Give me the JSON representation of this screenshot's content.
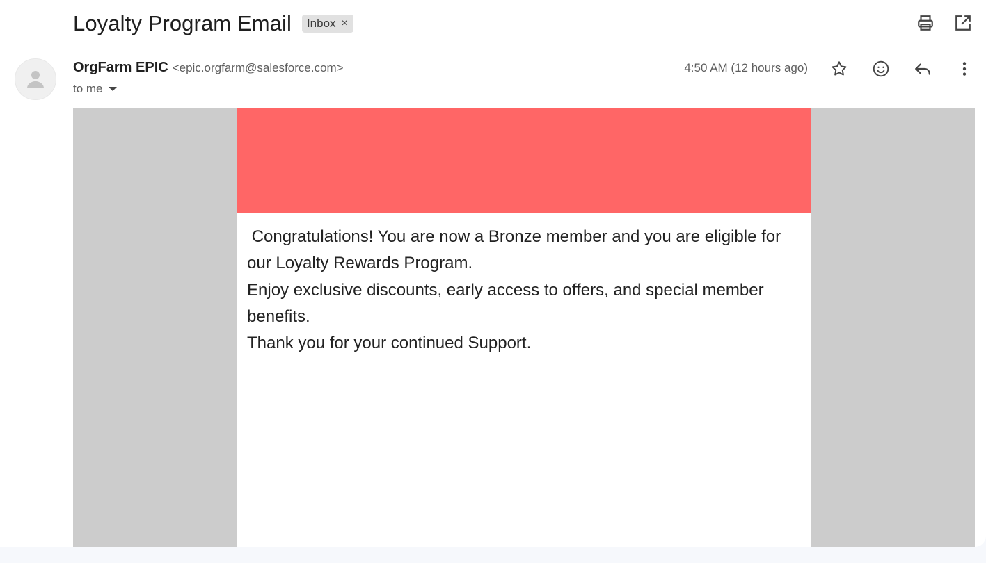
{
  "email": {
    "subject": "Loyalty Program Email",
    "label": "Inbox",
    "label_close": "×",
    "sender_name": "OrgFarm EPIC",
    "sender_email": "<epic.orgfarm@salesforce.com>",
    "recipient": "to me",
    "timestamp": "4:50 AM (12 hours ago)"
  },
  "toolbar": {
    "print_icon": "print-icon",
    "open_new_window_icon": "open-in-new-window-icon"
  },
  "message_actions": [
    "star-icon",
    "emoji-reaction-icon",
    "reply-icon",
    "more-options-icon"
  ],
  "body": {
    "banner_color": "#ff6666",
    "background_color": "#cccccc",
    "paragraphs": [
      " Congratulations! You are now a Bronze member and you are eligible for our Loyalty Rewards Program.",
      "Enjoy exclusive discounts, early access to offers, and special member benefits.",
      "Thank you for your continued Support."
    ]
  }
}
